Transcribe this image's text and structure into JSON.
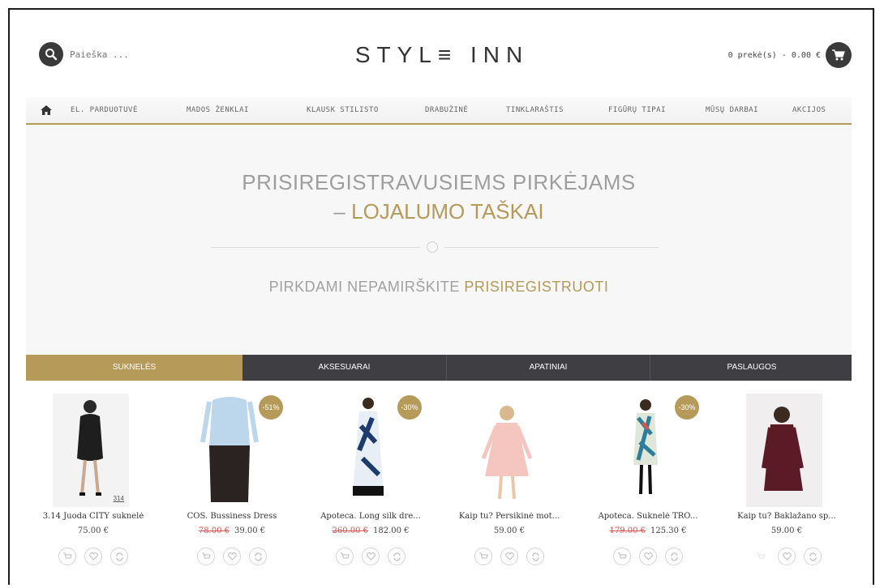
{
  "header": {
    "search_placeholder": "Paieška ...",
    "logo": "STYL≡ INN",
    "cart_summary": "0 prekė(s) - 0.00 €"
  },
  "nav": {
    "items": [
      "EL. PARDUOTUVĖ",
      "MADOS ŽENKLAI",
      "KLAUSK STILISTO",
      "DRABUŽINĖ",
      "TINKLARAŠTIS",
      "FIGŪRŲ TIPAI",
      "MŪSŲ DARBAI",
      "AKCIJOS"
    ]
  },
  "banner": {
    "line1": "PRISIREGISTRAVUSIEMS PIRKĖJAMS",
    "line2_dash": "– ",
    "line2_highlight": "LOJALUMO TAŠKAI",
    "line3_plain": "PIRKDAMI NEPAMIRŠKITE ",
    "line3_highlight": "PRISIREGISTRUOTI"
  },
  "tabs": [
    "SUKNELĖS",
    "AKSESUARAI",
    "APATINIAI",
    "PASLAUGOS"
  ],
  "products": [
    {
      "name": "3.14 Juoda CITY suknelė",
      "old_price": "",
      "price": "75.00 €",
      "badge": "",
      "image_tag": "314"
    },
    {
      "name": "COS. Bussiness Dress",
      "old_price": "78.00 €",
      "price": "39.00 €",
      "badge": "-51%",
      "image_tag": ""
    },
    {
      "name": "Apoteca. Long silk dre...",
      "old_price": "260.00 €",
      "price": "182.00 €",
      "badge": "-30%",
      "image_tag": ""
    },
    {
      "name": "Kaip tu? Persikinė mot...",
      "old_price": "",
      "price": "59.00 €",
      "badge": "",
      "image_tag": ""
    },
    {
      "name": "Apoteca. Suknelė TRO...",
      "old_price": "179.00 €",
      "price": "125.30 €",
      "badge": "-30%",
      "image_tag": ""
    },
    {
      "name": "Kaip tu? Baklažano sp...",
      "old_price": "",
      "price": "59.00 €",
      "badge": "",
      "image_tag": ""
    }
  ],
  "colors": {
    "accent": "#b59a5a",
    "dark": "#3e3e43",
    "banner_bg": "#f7f7f7"
  }
}
